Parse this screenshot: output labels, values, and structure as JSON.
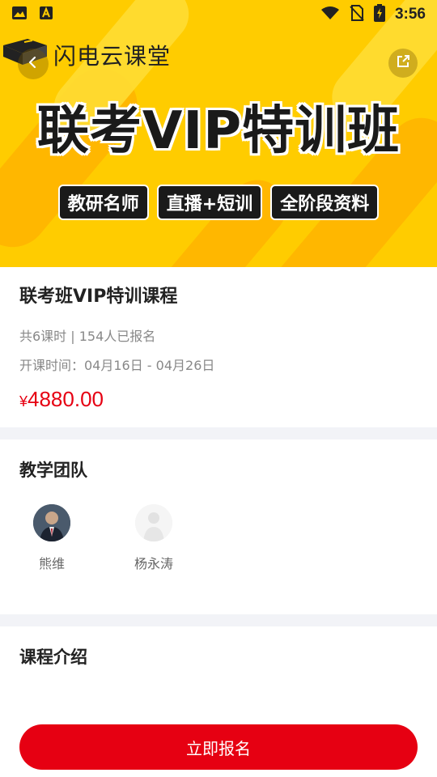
{
  "status_bar": {
    "time": "3:56",
    "icons": [
      "image-icon",
      "a-icon",
      "wifi-icon",
      "no-sim-icon",
      "battery-charging-icon"
    ]
  },
  "banner": {
    "brand": "闪电云课堂",
    "headline": "联考VIP特训班",
    "tags": [
      "教研名师",
      "直播+短训",
      "全阶段资料"
    ],
    "colors": {
      "background": "#ffcc00",
      "stripe": "#ffb300"
    }
  },
  "course": {
    "title": "联考班VIP特训课程",
    "meta": "共6课时 | 154人已报名",
    "schedule": "开课时间：04月16日 - 04月26日",
    "price_symbol": "¥",
    "price": "4880.00"
  },
  "team": {
    "title": "教学团队",
    "teachers": [
      {
        "name": "熊维"
      },
      {
        "name": "杨永涛"
      }
    ]
  },
  "intro": {
    "title": "课程介绍"
  },
  "actions": {
    "enroll_label": "立即报名",
    "accent_color": "#e60012"
  }
}
